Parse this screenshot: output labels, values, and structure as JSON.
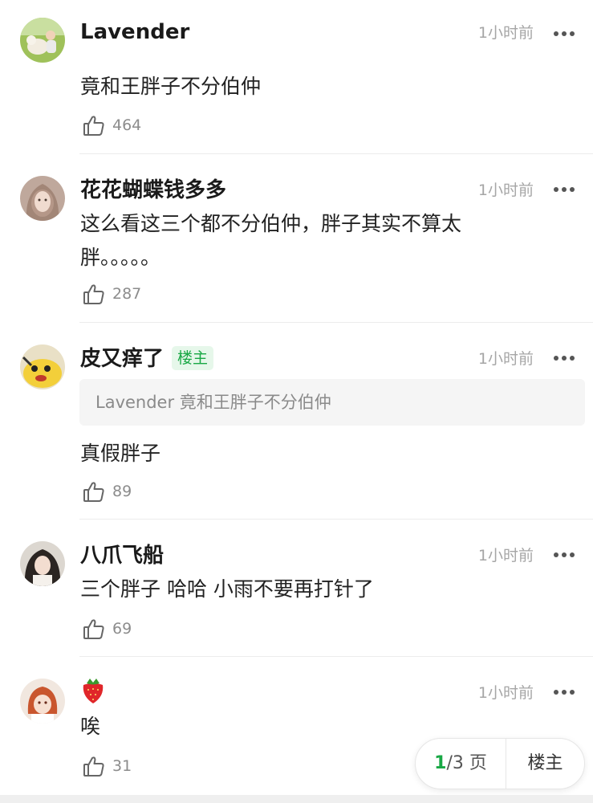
{
  "comments": [
    {
      "name": "Lavender",
      "time": "1小时前",
      "text": "竟和王胖子不分伯仲",
      "likes": "464"
    },
    {
      "name": "花花蝴蝶钱多多",
      "time": "1小时前",
      "text": "这么看这三个都不分伯仲，胖子其实不算太胖。。。。。",
      "likes": "287"
    },
    {
      "name": "皮又痒了",
      "badge": "楼主",
      "time": "1小时前",
      "quote": "Lavender 竟和王胖子不分伯仲",
      "text": "真假胖子",
      "likes": "89"
    },
    {
      "name": "八爪飞船",
      "time": "1小时前",
      "text": "三个胖子 哈哈 小雨不要再打针了",
      "likes": "69"
    },
    {
      "name": "🍓",
      "time": "1小时前",
      "text": "唉",
      "likes": "31"
    }
  ],
  "pager": {
    "current": "1",
    "total": "/3 页",
    "owner_label": "楼主"
  },
  "colors": {
    "accent": "#19a845",
    "badge_bg": "#e6f7ea",
    "time": "#a6a6a6"
  }
}
